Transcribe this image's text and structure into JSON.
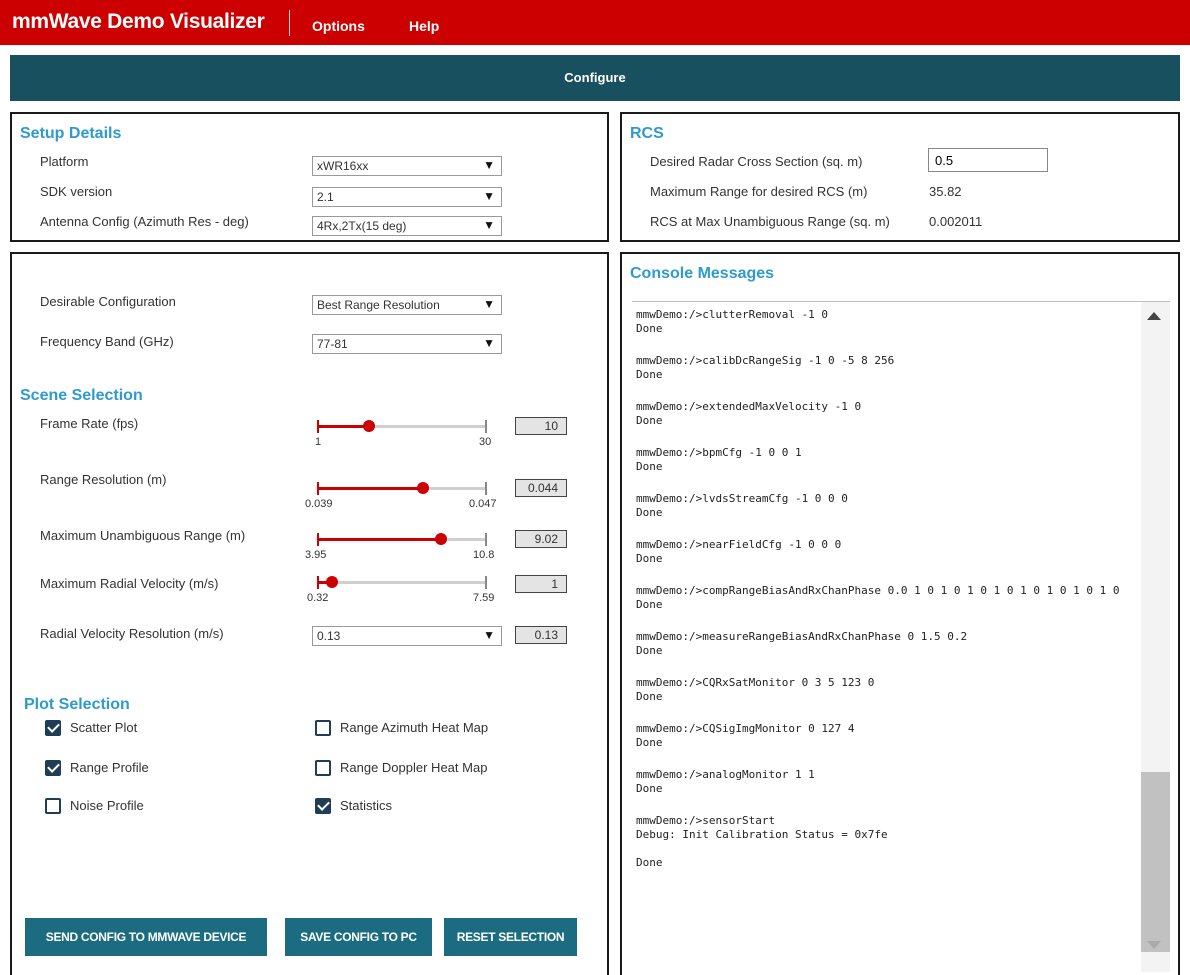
{
  "app": {
    "title": "mmWave Demo Visualizer"
  },
  "menu": {
    "options": "Options",
    "help": "Help"
  },
  "configure": {
    "label": "Configure"
  },
  "setup": {
    "title": "Setup Details",
    "platform_label": "Platform",
    "platform_value": "xWR16xx",
    "sdk_label": "SDK version",
    "sdk_value": "2.1",
    "antenna_label": "Antenna Config (Azimuth Res - deg)",
    "antenna_value": "4Rx,2Tx(15 deg)"
  },
  "rcs": {
    "title": "RCS",
    "desired_label": "Desired Radar Cross Section (sq. m)",
    "desired_value": "0.5",
    "max_range_label": "Maximum Range for desired RCS (m)",
    "max_range_value": "35.82",
    "rcs_max_label": "RCS at Max Unambiguous Range (sq. m)",
    "rcs_max_value": "0.002011"
  },
  "config": {
    "desirable_label": "Desirable Configuration",
    "desirable_value": "Best Range Resolution",
    "freq_label": "Frequency Band (GHz)",
    "freq_value": "77-81"
  },
  "scene": {
    "title": "Scene Selection",
    "frame_rate": {
      "label": "Frame Rate (fps)",
      "min": "1",
      "max": "30",
      "value": "10",
      "fraction": 0.31
    },
    "range_res": {
      "label": "Range Resolution (m)",
      "min": "0.039",
      "max": "0.047",
      "value": "0.044",
      "fraction": 0.63
    },
    "max_range": {
      "label": "Maximum Unambiguous Range (m)",
      "min": "3.95",
      "max": "10.8",
      "value": "9.02",
      "fraction": 0.74
    },
    "max_vel": {
      "label": "Maximum Radial Velocity (m/s)",
      "min": "0.32",
      "max": "7.59",
      "value": "1",
      "fraction": 0.09
    },
    "vel_res": {
      "label": "Radial Velocity Resolution (m/s)",
      "select_value": "0.13",
      "value": "0.13"
    }
  },
  "plot": {
    "title": "Plot Selection",
    "scatter": "Scatter Plot",
    "range_profile": "Range Profile",
    "noise_profile": "Noise Profile",
    "range_azimuth": "Range Azimuth Heat Map",
    "range_doppler": "Range Doppler Heat Map",
    "statistics": "Statistics"
  },
  "buttons": {
    "send": "SEND CONFIG TO MMWAVE DEVICE",
    "save": "SAVE CONFIG TO PC",
    "reset": "RESET SELECTION"
  },
  "console": {
    "title": "Console Messages",
    "entries": [
      "mmwDemo:/>clutterRemoval -1 0\nDone",
      "mmwDemo:/>calibDcRangeSig -1 0 -5 8 256\nDone",
      "mmwDemo:/>extendedMaxVelocity -1 0\nDone",
      "mmwDemo:/>bpmCfg -1 0 0 1\nDone",
      "mmwDemo:/>lvdsStreamCfg -1 0 0 0\nDone",
      "mmwDemo:/>nearFieldCfg -1 0 0 0\nDone",
      "mmwDemo:/>compRangeBiasAndRxChanPhase 0.0 1 0 1 0 1 0 1 0 1 0 1 0 1 0 1 0\nDone",
      "mmwDemo:/>measureRangeBiasAndRxChanPhase 0 1.5 0.2\nDone",
      "mmwDemo:/>CQRxSatMonitor 0 3 5 123 0\nDone",
      "mmwDemo:/>CQSigImgMonitor 0 127 4\nDone",
      "mmwDemo:/>analogMonitor 1 1\nDone",
      "mmwDemo:/>sensorStart\nDebug: Init Calibration Status = 0x7fe\n\nDone"
    ]
  }
}
